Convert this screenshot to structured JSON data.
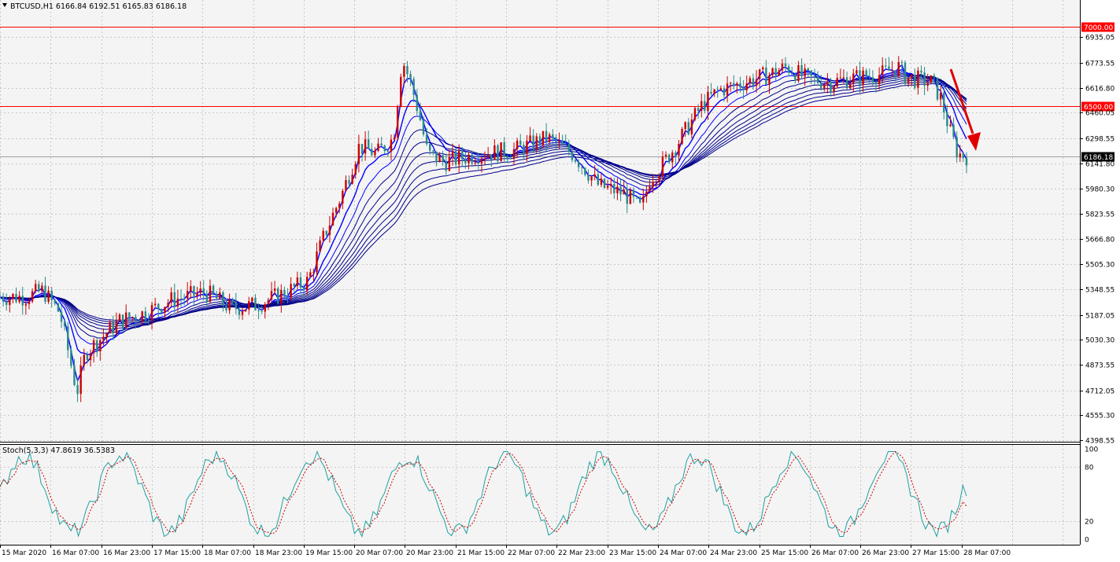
{
  "header": {
    "title": "BTCUSD,H1  6166.84 6192.51 6165.83 6186.18"
  },
  "colors": {
    "bull": "#cc0000",
    "bear": "#2a8a8a",
    "ma": "#00008b",
    "ma_light": "#0000ff",
    "grid": "#c8c8c8",
    "level": "#ff0000",
    "arrow": "#e00000",
    "stoch_main": "#20a0a0",
    "stoch_signal": "#cc0000"
  },
  "chart_data": [
    {
      "type": "candlestick",
      "symbol": "BTCUSD",
      "timeframe": "H1",
      "ylim": [
        4398.55,
        7020
      ],
      "y_ticks": [
        "6935.05",
        "6773.55",
        "6616.80",
        "6460.05",
        "6298.55",
        "6141.80",
        "5980.30",
        "5823.55",
        "5666.80",
        "5505.30",
        "5348.55",
        "5187.05",
        "5030.30",
        "4873.55",
        "4712.05",
        "4555.30",
        "4398.55"
      ],
      "x_labels": [
        "15 Mar 2020",
        "16 Mar 07:00",
        "16 Mar 23:00",
        "17 Mar 15:00",
        "18 Mar 07:00",
        "18 Mar 23:00",
        "19 Mar 15:00",
        "20 Mar 07:00",
        "20 Mar 23:00",
        "21 Mar 15:00",
        "22 Mar 07:00",
        "22 Mar 23:00",
        "23 Mar 15:00",
        "24 Mar 07:00",
        "24 Mar 23:00",
        "25 Mar 15:00",
        "26 Mar 07:00",
        "26 Mar 23:00",
        "27 Mar 15:00",
        "28 Mar 07:00"
      ],
      "last_ohlc": {
        "open": 6166.84,
        "high": 6192.51,
        "low": 6165.83,
        "close": 6186.18
      },
      "horizontal_levels": [
        {
          "value": 7000,
          "label": "7000.00"
        },
        {
          "value": 6500,
          "label": "6500.00"
        }
      ],
      "current_price": {
        "value": 6186.18,
        "label": "6186.18"
      },
      "price_path": [
        [
          0,
          5300
        ],
        [
          3,
          5300
        ],
        [
          5,
          5340
        ],
        [
          7,
          5200
        ],
        [
          8,
          4950
        ],
        [
          9,
          4700
        ],
        [
          10,
          4950
        ],
        [
          11,
          5000
        ],
        [
          12,
          5050
        ],
        [
          14,
          5150
        ],
        [
          17,
          5200
        ],
        [
          20,
          5280
        ],
        [
          24,
          5330
        ],
        [
          27,
          5230
        ],
        [
          30,
          5250
        ],
        [
          33,
          5320
        ],
        [
          36,
          5400
        ],
        [
          38,
          5700
        ],
        [
          40,
          5950
        ],
        [
          42,
          6250
        ],
        [
          44,
          6200
        ],
        [
          46,
          6300
        ],
        [
          47,
          6800
        ],
        [
          48,
          6650
        ],
        [
          49,
          6450
        ],
        [
          50,
          6200
        ],
        [
          52,
          6150
        ],
        [
          56,
          6200
        ],
        [
          60,
          6220
        ],
        [
          64,
          6300
        ],
        [
          67,
          6200
        ],
        [
          70,
          6000
        ],
        [
          73,
          5950
        ],
        [
          75,
          5850
        ],
        [
          76,
          6050
        ],
        [
          77,
          6100
        ],
        [
          79,
          6250
        ],
        [
          82,
          6500
        ],
        [
          84,
          6600
        ],
        [
          87,
          6650
        ],
        [
          90,
          6700
        ],
        [
          92,
          6750
        ],
        [
          94,
          6680
        ],
        [
          97,
          6650
        ],
        [
          100,
          6680
        ],
        [
          103,
          6700
        ],
        [
          105,
          6750
        ],
        [
          106,
          6680
        ],
        [
          109,
          6650
        ],
        [
          110,
          6550
        ],
        [
          111,
          6350
        ],
        [
          112,
          6200
        ],
        [
          113,
          6186
        ]
      ],
      "moving_averages": {
        "count": 10,
        "note": "Guppy-style EMA ribbon"
      },
      "annotation": {
        "type": "arrow",
        "direction": "down"
      }
    },
    {
      "type": "line",
      "title": "Stoch(5,3,3) 47.8619 36.5383",
      "ylim": [
        0,
        100
      ],
      "y_ticks": [
        "100",
        "80",
        "20",
        "0"
      ],
      "series": [
        {
          "name": "Main",
          "value": 47.8619
        },
        {
          "name": "Signal",
          "value": 36.5383
        }
      ],
      "x_labels_shared": true
    }
  ]
}
